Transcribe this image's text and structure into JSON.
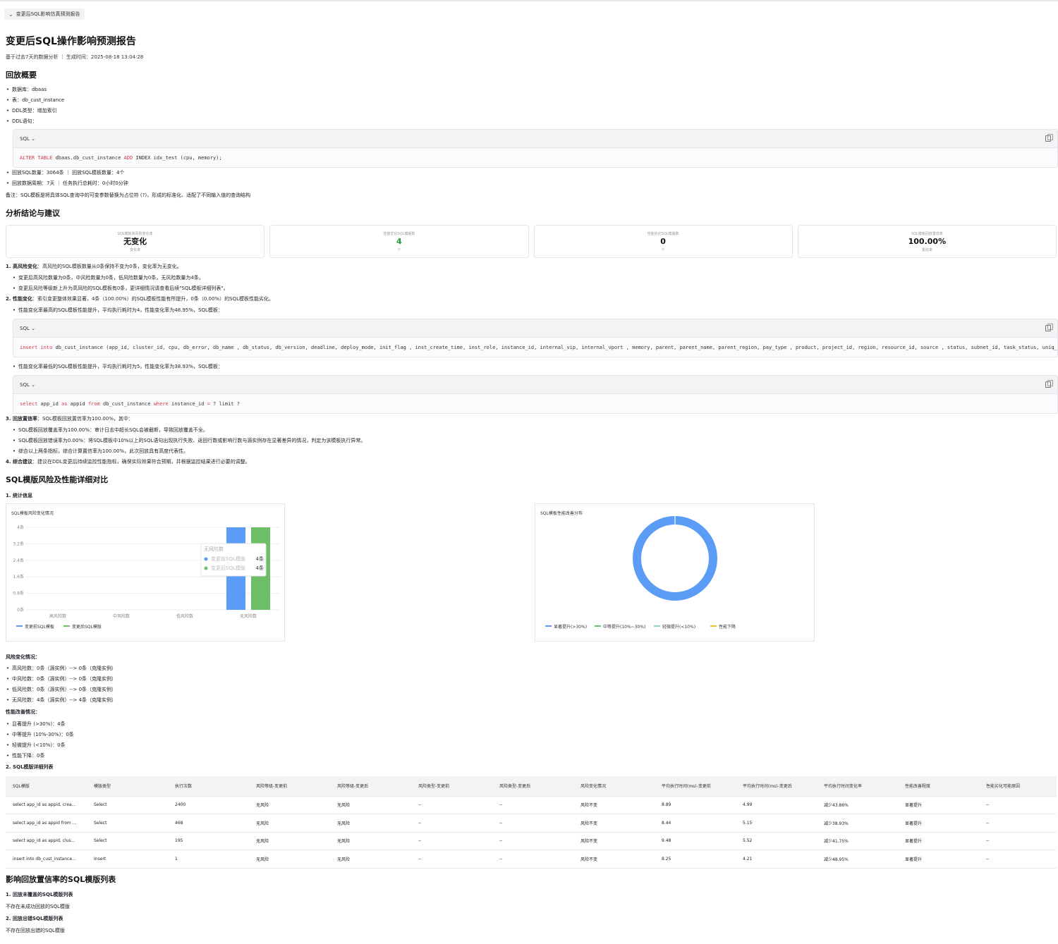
{
  "collapse_label": "变更后SQL影响仿真预测报告",
  "title": "变更后SQL操作影响预测报告",
  "meta": "基于过去7天的数据分析 ｜ 生成时间：2025-08-18 13:04:28",
  "overview": {
    "heading": "回放概要",
    "items": [
      "数据库：dbaas",
      "表：db_cust_instance",
      "DDL类型：增加索引",
      "DDL语句："
    ],
    "code_label": "SQL",
    "code_kw1": "ALTER TABLE",
    "code_mid": " dbaas.db_cust_instance ",
    "code_kw2": "ADD",
    "code_rest": " INDEX idx_test (cpu, memory);",
    "items2": [
      "回放SQL数量：3064条 ｜ 回放SQL模板数量：4个",
      "回放数据周期：7天 ｜ 任务执行总耗时：0小时0分钟"
    ],
    "note": "备注：SQL模板是将具体SQL查询中的可变参数替换为占位符 (?)，形成的标准化、适配了不同输入值的查询结构"
  },
  "analysis": {
    "heading": "分析结论与建议",
    "cards": [
      {
        "label": "SQL模板高风险变化率",
        "value": "无变化",
        "unit": "变化率"
      },
      {
        "label": "性能优化SQL模版数",
        "value": "4",
        "unit": "个"
      },
      {
        "label": "性能劣化SQL模版数",
        "value": "0",
        "unit": "个"
      },
      {
        "label": "SQL模板回放置信率",
        "value": "100.00%",
        "unit": "置信率"
      }
    ],
    "p1_title": "1. 高风险变化",
    "p1_text": "：高风险的SQL模板数量从0条保持不变为0条，变化率为无变化。",
    "p1_items": [
      "变更后高风险数量为0条，中风险数量为0条，低风险数量为0条，无风险数量为4条。",
      "变更后风险等级新上升为高风险的SQL模板有0条，更详细情况请查看后续\"SQL模板详细列表\"。"
    ],
    "p2_title": "2. 性能变化",
    "p2_text": "：索引变更整体效果显著，4条（100.00%）的SQL模板性能有所提升，0条（0.00%）的SQL模板性能劣化。",
    "p2_item1": "性能变化率最高的SQL模板性能提升，平均执行耗时为4，性能变化率为48.95%，SQL模板：",
    "code2_kw": "insert into",
    "code2_rest": " db_cust_instance (app_id, cluster_id, cpu, db_error, db_name , db_status, db_version, deadline, deploy_mode, init_flag , inst_create_time, inst_role, instance_id, internal_vip, internal_vport , memory, parent, parent_name, parent_region, pay_type , product, project_id, region, resource_id, source , status, subnet_id, task_status, uniq_subnet_id,",
    "p2_item2": "性能变化率最低的SQL模板性能提升，平均执行耗时为5，性能变化率为38.93%，SQL模板：",
    "code3_kw1": "select",
    "code3_a": " app_id ",
    "code3_kw2": "as",
    "code3_b": " appid ",
    "code3_kw3": "from",
    "code3_c": " db_cust_instance ",
    "code3_kw4": "where",
    "code3_d": " instance_id ",
    "code3_kw5": "=",
    "code3_e": " ? limit ?",
    "p3_title": "3. 回放置信率",
    "p3_text": "：SQL模板回放置信率为100.00%，其中：",
    "p3_items": [
      "SQL模板回放覆盖率为100.00%：审计日志中超长SQL会被截断，导致回放覆盖不全。",
      "SQL模板回放错误率为0.00%：将SQL模板中10%以上的SQL语句出现执行失败、返回行数或影响行数与源实例存在显著差异的情况，判定为该模板执行异常。",
      "综合以上两条指标，综合计算置信率为100.00%，此次回放具有高度代表性。"
    ],
    "p4_title": "4. 综合建议",
    "p4_text": "：建议在DDL变更后持续监控性能指标，确保实际效果符合预期，并根据监控结果进行必要的调整。"
  },
  "details": {
    "heading": "SQL模版风险及性能详细对比",
    "sub1": "1. 统计信息",
    "risk_heading": "风险变化情况：",
    "risk_items": [
      "高风险数：0条（源实例）--> 0条（克隆实例）",
      "中风险数：0条（源实例）--> 0条（克隆实例）",
      "低风险数：0条（源实例）--> 0条（克隆实例）",
      "无风险数：4条（源实例）--> 4条（克隆实例）"
    ],
    "perf_heading": "性能改善情况：",
    "perf_items": [
      "显著提升 (>30%)：4条",
      "中等提升 (10%-30%)：0条",
      "轻微提升 (<10%)：0条",
      "性能下降：0条"
    ],
    "sub2": "2. SQL模版详细列表"
  },
  "chart_data": [
    {
      "type": "bar",
      "title": "SQL模板风险变化情况",
      "categories": [
        "高风险数",
        "中风险数",
        "低风险数",
        "无风险数"
      ],
      "yticks": [
        "0条",
        "0.8条",
        "1.6条",
        "2.4条",
        "3.2条",
        "4条"
      ],
      "ylim": [
        0,
        4
      ],
      "series": [
        {
          "name": "变更前SQL模板",
          "values": [
            0,
            0,
            0,
            4
          ],
          "color": "#5b9cf6"
        },
        {
          "name": "变更后SQL模版",
          "values": [
            0,
            0,
            0,
            4
          ],
          "color": "#6cbf66"
        }
      ],
      "tooltip": {
        "title": "无风险数",
        "rows": [
          {
            "name": "变更前SQL模版",
            "value": "4条"
          },
          {
            "name": "变更后SQL模版",
            "value": "4条"
          }
        ]
      },
      "legend": "bottom-left"
    },
    {
      "type": "pie",
      "title": "SQL模板性能改善分布",
      "slices": [
        {
          "name": "显著提升(>30%)",
          "value": 4,
          "color": "#5b9cf6"
        },
        {
          "name": "中等提升(10%~30%)",
          "value": 0,
          "color": "#6cbf66"
        },
        {
          "name": "轻微提升(<10%)",
          "value": 0,
          "color": "#8ed1d6"
        },
        {
          "name": "性能下降",
          "value": 0,
          "color": "#f2c037"
        }
      ],
      "legend": "bottom-left"
    }
  ],
  "table": {
    "headers": [
      "SQL模版",
      "模版类型",
      "执行次数",
      "风险等级-变更前",
      "风险等级-变更后",
      "风险类型-变更前",
      "风险类型-变更后",
      "风险变化情况",
      "平均执行时间(ms)-变更前",
      "平均执行时间(ms)-变更后",
      "平均执行时间变化率",
      "性能改善程度",
      "性能劣化可能原因"
    ],
    "rows": [
      [
        "select app_id as appid, crea...",
        "Select",
        "2400",
        "无风险",
        "无风险",
        "--",
        "--",
        "风险不变",
        "8.89",
        "4.99",
        "减少43.86%",
        "显著提升",
        "--"
      ],
      [
        "select app_id as appid from ...",
        "Select",
        "468",
        "无风险",
        "无风险",
        "--",
        "--",
        "风险不变",
        "8.44",
        "5.15",
        "减少38.93%",
        "显著提升",
        "--"
      ],
      [
        "select app_id as appid, clus...",
        "Select",
        "195",
        "无风险",
        "无风险",
        "--",
        "--",
        "风险不变",
        "9.48",
        "5.52",
        "减少41.75%",
        "显著提升",
        "--"
      ],
      [
        "insert into db_cust_instance...",
        "Insert",
        "1",
        "无风险",
        "无风险",
        "--",
        "--",
        "风险不变",
        "8.25",
        "4.21",
        "减少48.95%",
        "显著提升",
        "--"
      ]
    ]
  },
  "replay": {
    "heading": "影响回放置信率的SQL模版列表",
    "sub1": "1. 回放未覆盖的SQL模版列表",
    "text1": "不存在未成功回放的SQL模版",
    "sub2": "2. 回放出错SQL模版列表",
    "text2": "不存在回放出错的SQL模版"
  }
}
